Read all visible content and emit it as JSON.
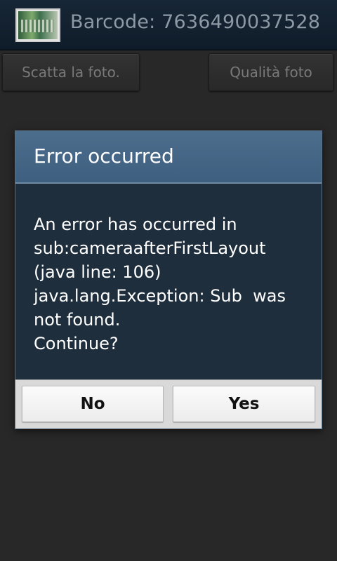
{
  "titlebar": {
    "title": "Barcode: 7636490037528",
    "icon": "product-photo-thumbnail"
  },
  "background_buttons": {
    "left_label": "Scatta la foto.",
    "right_label": "Qualità foto"
  },
  "dialog": {
    "title": "Error occurred",
    "message_lines": [
      "An error has occurred in",
      "sub:cameraafterFirstLayout",
      "(java line: 106)",
      "java.lang.Exception: Sub  was",
      "not found.",
      "Continue?"
    ],
    "buttons": {
      "no": "No",
      "yes": "Yes"
    }
  },
  "colors": {
    "titlebar_bg": "#172636",
    "dialog_header": "#46668a",
    "dialog_body": "#1f2e3d",
    "screen_bg": "#2e2e2e"
  }
}
